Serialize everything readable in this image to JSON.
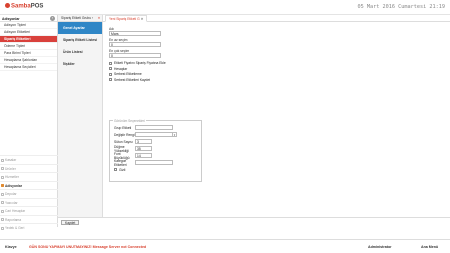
{
  "app": {
    "logo_main": "Samba",
    "logo_sub": "POS",
    "clock": "05 Mart 2016 Cumartesi 21:19"
  },
  "sidebar": {
    "header": "Adisyonlar",
    "items": [
      {
        "label": "Adisyon Tipleri"
      },
      {
        "label": "Adisyon Etiketleri"
      },
      {
        "label": "Sipariş Etiketleri"
      },
      {
        "label": "Ödeme Tipleri"
      },
      {
        "label": "Para Birimi Tipleri"
      },
      {
        "label": "Hesaplama Şablonları"
      },
      {
        "label": "Hesaplama Seçicileri"
      }
    ],
    "menu": [
      {
        "label": "Kasalar"
      },
      {
        "label": "Ürünler"
      },
      {
        "label": "Hizmetler"
      },
      {
        "label": "Adisyonlar"
      },
      {
        "label": "Depolar"
      },
      {
        "label": "Yazıcılar"
      },
      {
        "label": "Cari Hesaplar"
      },
      {
        "label": "Raporlama"
      },
      {
        "label": "Yedek & Geri"
      }
    ]
  },
  "subnav": {
    "tab": "Sipariş Etiketi Grubu ›",
    "items": [
      {
        "label": "Genel Ayarlar"
      },
      {
        "label": "Sipariş Etiketi Listesi"
      },
      {
        "label": "Ürün Listesi"
      },
      {
        "label": "İlişkiler"
      }
    ]
  },
  "content": {
    "tab": "Yeni Sipariş Etiketi G",
    "tab_close": "✕",
    "fields": {
      "name_label": "Adı",
      "name_value": "Mars",
      "min_label": "En az seçim",
      "min_value": "0",
      "max_label": "En çok seçim",
      "max_value": "0"
    },
    "checks": [
      {
        "label": "Etiketi Fiyatını Sipariş Fiyatına Ekle"
      },
      {
        "label": "Hesaplar"
      },
      {
        "label": "Serbest Etiketleme"
      },
      {
        "label": "Serbest Etiketleri Kaydet"
      }
    ],
    "group": {
      "title": "Görünüm Seçenekleri",
      "rows": [
        {
          "label": "Grup Etiketi",
          "value": ""
        },
        {
          "label": "Değiştir Rengi",
          "value": ""
        },
        {
          "label": "Sütun Sayısı",
          "value": "3"
        },
        {
          "label": "Düğme Yüksekliği",
          "value": "35"
        },
        {
          "label": "Font Büyüklüğü",
          "value": "14"
        },
        {
          "label": "Kategori Etiketleri",
          "value": ""
        },
        {
          "label": "Gizli",
          "value": ""
        }
      ]
    },
    "save_label": "Kaydet"
  },
  "status": {
    "left": "Klavye",
    "message": "GÜN SONU YAPMAYI UNUTMAYINIZ! Message Server not Connected",
    "user": "Administrator",
    "mainmenu": "Ana Menü"
  }
}
